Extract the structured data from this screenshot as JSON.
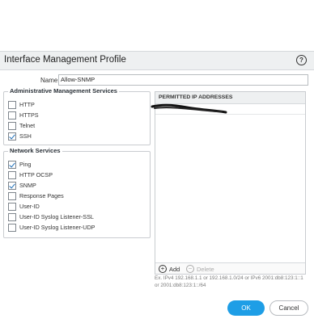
{
  "dialog": {
    "title": "Interface Management Profile",
    "help_icon": "question-icon"
  },
  "name_field": {
    "label": "Name",
    "value": "Allow-SNMP"
  },
  "admin_services": {
    "legend": "Administrative Management Services",
    "items": [
      {
        "label": "HTTP",
        "checked": false
      },
      {
        "label": "HTTPS",
        "checked": false
      },
      {
        "label": "Telnet",
        "checked": false
      },
      {
        "label": "SSH",
        "checked": true
      }
    ]
  },
  "network_services": {
    "legend": "Network Services",
    "items": [
      {
        "label": "Ping",
        "checked": true
      },
      {
        "label": "HTTP OCSP",
        "checked": false
      },
      {
        "label": "SNMP",
        "checked": true
      },
      {
        "label": "Response Pages",
        "checked": false
      },
      {
        "label": "User-ID",
        "checked": false
      },
      {
        "label": "User-ID Syslog Listener-SSL",
        "checked": false
      },
      {
        "label": "User-ID Syslog Listener-UDP",
        "checked": false
      }
    ]
  },
  "permitted_ips": {
    "header": "PERMITTED IP ADDRESSES",
    "add_label": "Add",
    "delete_label": "Delete",
    "hint": "Ex. IPv4 192.168.1.1 or 192.168.1.0/24 or IPv6 2001:db8:123:1::1 or 2001:db8:123:1::/64"
  },
  "actions": {
    "ok_label": "OK",
    "cancel_label": "Cancel"
  },
  "colors": {
    "primary": "#1e9ee6",
    "checkmark": "#1f6fb9",
    "titlebar": "#eef0f1"
  }
}
